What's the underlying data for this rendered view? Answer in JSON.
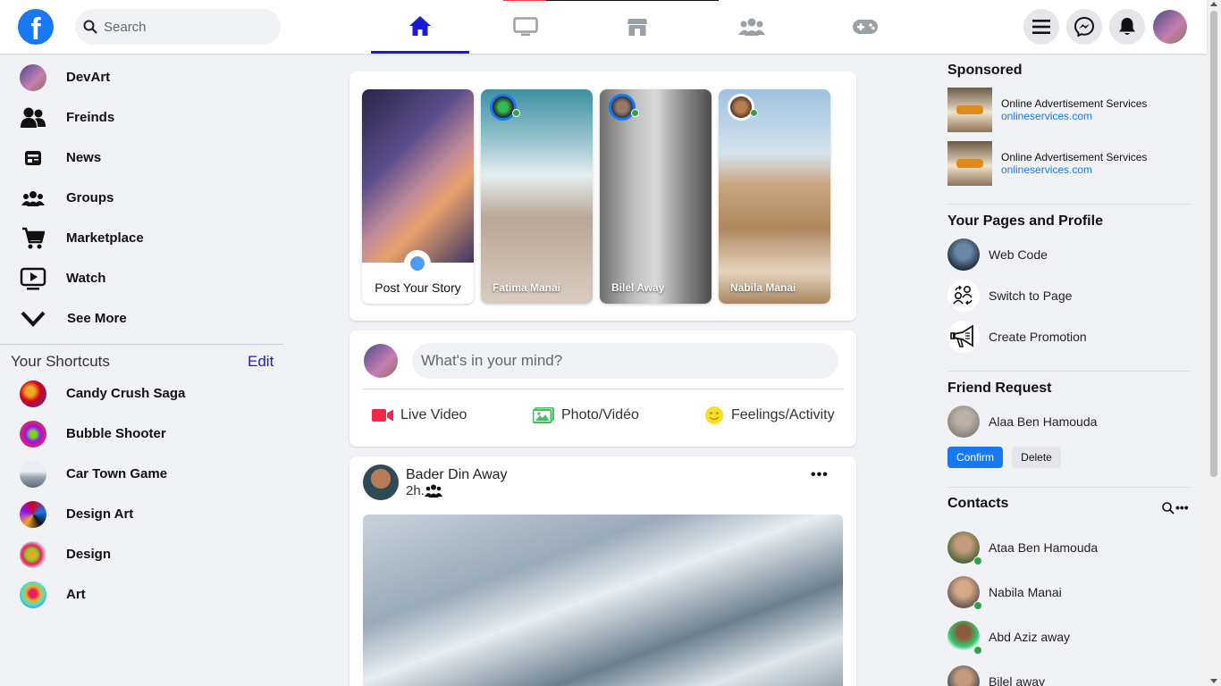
{
  "colors": {
    "brand": "#1877f2",
    "active_tab": "#1b1bd6",
    "online": "#31a24c",
    "live": "#f02849",
    "photo": "#45bd62",
    "feeling": "#f7b928"
  },
  "header": {
    "logo_letter": "f",
    "search_placeholder": "Search",
    "tabs": [
      {
        "icon": "home-icon",
        "active": true
      },
      {
        "icon": "watch-icon",
        "active": false
      },
      {
        "icon": "marketplace-icon",
        "active": false
      },
      {
        "icon": "groups-icon",
        "active": false
      },
      {
        "icon": "gaming-icon",
        "active": false
      }
    ],
    "actions": [
      "menu-icon",
      "messenger-icon",
      "notifications-icon"
    ]
  },
  "sidebar": {
    "items": [
      {
        "label": "DevArt",
        "icon": "profile-avatar"
      },
      {
        "label": "Freinds",
        "icon": "friends-icon"
      },
      {
        "label": "News",
        "icon": "news-icon"
      },
      {
        "label": "Groups",
        "icon": "groups-icon"
      },
      {
        "label": "Marketplace",
        "icon": "cart-icon"
      },
      {
        "label": "Watch",
        "icon": "watch-icon"
      },
      {
        "label": "See More",
        "icon": "chevron-down-icon"
      }
    ],
    "shortcuts_title": "Your Shortcuts",
    "edit_label": "Edit",
    "shortcuts": [
      {
        "label": "Candy Crush Saga"
      },
      {
        "label": "Bubble Shooter"
      },
      {
        "label": "Car Town Game"
      },
      {
        "label": "Design Art"
      },
      {
        "label": "Design"
      },
      {
        "label": "Art"
      }
    ]
  },
  "stories": {
    "post_label": "Post Your Story",
    "items": [
      {
        "name": "Fatima Manai"
      },
      {
        "name": "Bilel Away"
      },
      {
        "name": "Nabila Manai"
      }
    ]
  },
  "composer": {
    "placeholder": "What's in your mind?",
    "actions": [
      {
        "label": "Live Video",
        "icon": "live-video-icon"
      },
      {
        "label": "Photo/Vidéo",
        "icon": "photo-icon"
      },
      {
        "label": "Feelings/Activity",
        "icon": "feeling-icon"
      }
    ]
  },
  "post": {
    "author": "Bader Din Away",
    "time": "2h.",
    "audience_icon": "friends-icon",
    "more": "•••"
  },
  "right": {
    "sponsored_title": "Sponsored",
    "ads": [
      {
        "title": "Online Advertisement Services",
        "link": "onlineservices.com"
      },
      {
        "title": "Online Advertisement Services",
        "link": "onlineservices.com"
      }
    ],
    "pages_title": "Your Pages and Profile",
    "pages": [
      {
        "label": "Web Code",
        "icon": "page-avatar"
      },
      {
        "label": "Switch to Page",
        "icon": "switch-icon"
      },
      {
        "label": "Create Promotion",
        "icon": "megaphone-icon"
      }
    ],
    "friend_request_title": "Friend Request",
    "friend_request": {
      "name": "Alaa Ben Hamouda",
      "confirm": "Confirm",
      "delete": "Delete"
    },
    "contacts_title": "Contacts",
    "contacts_more": "•••",
    "contacts": [
      {
        "name": "Ataa Ben Hamouda",
        "online": true
      },
      {
        "name": "Nabila Manai",
        "online": true
      },
      {
        "name": "Abd Aziz away",
        "online": true
      },
      {
        "name": "Bilel away",
        "online": false
      }
    ]
  }
}
